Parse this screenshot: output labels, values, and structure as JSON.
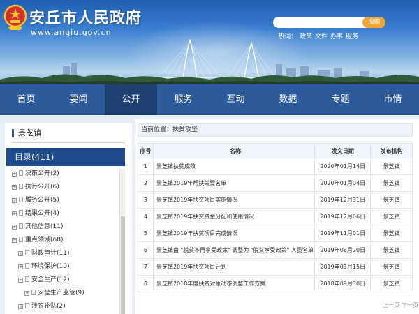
{
  "header": {
    "site_title": "安丘市人民政府",
    "site_url": "www.anqiu.gov.cn",
    "search_placeholder": "",
    "search_button": "搜索",
    "hotwords_label": "热词：",
    "hotwords": [
      "政策",
      "文件",
      "办事",
      "服务"
    ]
  },
  "nav": {
    "items": [
      "首页",
      "要闻",
      "公开",
      "服务",
      "互动",
      "数据",
      "专题",
      "市情"
    ],
    "active_index": 2
  },
  "sidebar": {
    "title": "景芝镇",
    "catalog_label": "目录(411)",
    "tree": [
      {
        "label": "决策公开(2)",
        "level": 0,
        "expanded": false
      },
      {
        "label": "执行公开(6)",
        "level": 0,
        "expanded": false
      },
      {
        "label": "服务公开(5)",
        "level": 0,
        "expanded": false
      },
      {
        "label": "结果公开(4)",
        "level": 0,
        "expanded": false
      },
      {
        "label": "其他信息(11)",
        "level": 0,
        "expanded": false
      },
      {
        "label": "重点领域(68)",
        "level": 0,
        "expanded": true
      },
      {
        "label": "财政审计(11)",
        "level": 1,
        "expanded": false
      },
      {
        "label": "环境保护(10)",
        "level": 1,
        "expanded": false
      },
      {
        "label": "安全生产(12)",
        "level": 1,
        "expanded": true
      },
      {
        "label": "安全生产监管(9)",
        "level": 2,
        "expanded": false
      },
      {
        "label": "涉农补贴(2)",
        "level": 1,
        "expanded": false
      }
    ]
  },
  "main": {
    "breadcrumb": "当前位置：扶贫攻坚",
    "columns": [
      "序号",
      "名称",
      "发文日期",
      "发布机构"
    ],
    "rows": [
      {
        "no": "1",
        "name": "景芝镇扶贫成效",
        "date": "2020年01月14日",
        "org": "景芝镇"
      },
      {
        "no": "2",
        "name": "景芝镇2019年帮扶关爱名单",
        "date": "2020年01月04日",
        "org": "景芝镇"
      },
      {
        "no": "3",
        "name": "景芝镇2019年扶贫项目实施情况",
        "date": "2019年12月31日",
        "org": "景芝镇"
      },
      {
        "no": "4",
        "name": "景芝镇2019年扶贫资金分配和使用情况",
        "date": "2019年12月06日",
        "org": "景芝镇"
      },
      {
        "no": "5",
        "name": "景芝镇2019年扶贫项目完成情况",
        "date": "2019年11月01日",
        "org": "景芝镇"
      },
      {
        "no": "6",
        "name": "景芝镇由 \"脱贫不再享受政策\" 调整为 \"脱贫享受政策\" 人员名单",
        "date": "2019年08月20日",
        "org": "景芝镇"
      },
      {
        "no": "7",
        "name": "景芝镇2019年扶贫项目计划",
        "date": "2019年03月15日",
        "org": "景芝镇"
      },
      {
        "no": "8",
        "name": "景芝镇2018年度扶贫对象动态调整工作方案",
        "date": "2018年09月30日",
        "org": "景芝镇"
      }
    ],
    "pager": {
      "prev": "上一页",
      "next": "下一页"
    }
  },
  "colors": {
    "nav_bg": "#2c5a9a",
    "nav_active": "#1d3f72",
    "catalog_bar": "#1e4b8e",
    "search_button": "#f0a432"
  }
}
